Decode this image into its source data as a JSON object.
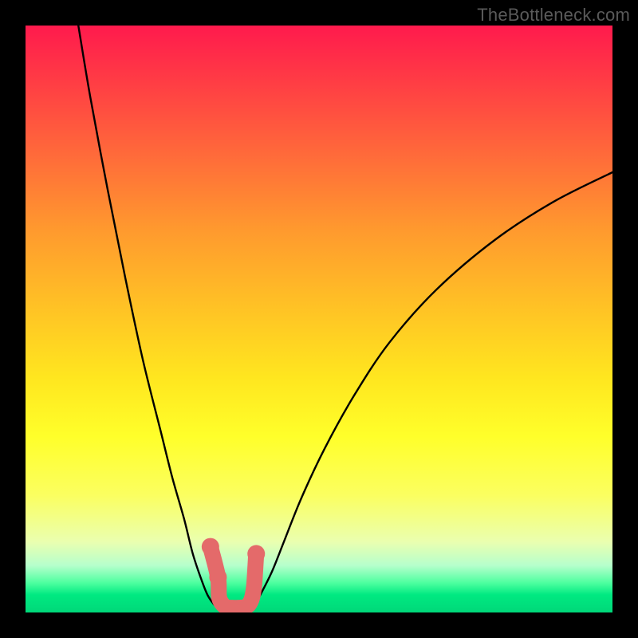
{
  "watermark": "TheBottleneck.com",
  "chart_data": {
    "type": "line",
    "title": "",
    "xlabel": "",
    "ylabel": "",
    "xlim": [
      0,
      100
    ],
    "ylim": [
      0,
      100
    ],
    "grid": false,
    "series": [
      {
        "name": "left-curve",
        "x": [
          9,
          11,
          14,
          17,
          20,
          23,
          25,
          27,
          28.5,
          30,
          31,
          32,
          32.8,
          33.4,
          33.8
        ],
        "y": [
          100,
          88,
          72,
          57,
          43,
          31,
          23,
          16,
          10,
          5.5,
          3,
          1.5,
          0.7,
          0.2,
          0
        ]
      },
      {
        "name": "right-curve",
        "x": [
          38,
          39,
          40,
          42,
          44,
          47,
          51,
          56,
          62,
          70,
          80,
          90,
          100
        ],
        "y": [
          0,
          1.3,
          3,
          7,
          12,
          19.5,
          28,
          37,
          46,
          55,
          63.5,
          70,
          75
        ]
      },
      {
        "name": "valley-flat",
        "x": [
          33.8,
          34.5,
          35.5,
          36.5,
          37.3,
          38
        ],
        "y": [
          0,
          0,
          0,
          0,
          0,
          0
        ]
      },
      {
        "name": "blobs",
        "type": "scatter",
        "x": [
          31.5,
          32.8,
          33.0,
          34.0,
          35.2,
          36.3,
          37.3,
          38.0,
          38.5,
          38.8,
          39.0,
          39.3
        ],
        "y": [
          11.2,
          6.0,
          2.5,
          1.0,
          0.8,
          0.8,
          0.9,
          1.3,
          2.2,
          3.5,
          5.2,
          10.0
        ]
      }
    ],
    "colors": {
      "curve": "#000000",
      "blob_fill": "#e46a6a",
      "blob_stroke": "#e46a6a"
    }
  }
}
